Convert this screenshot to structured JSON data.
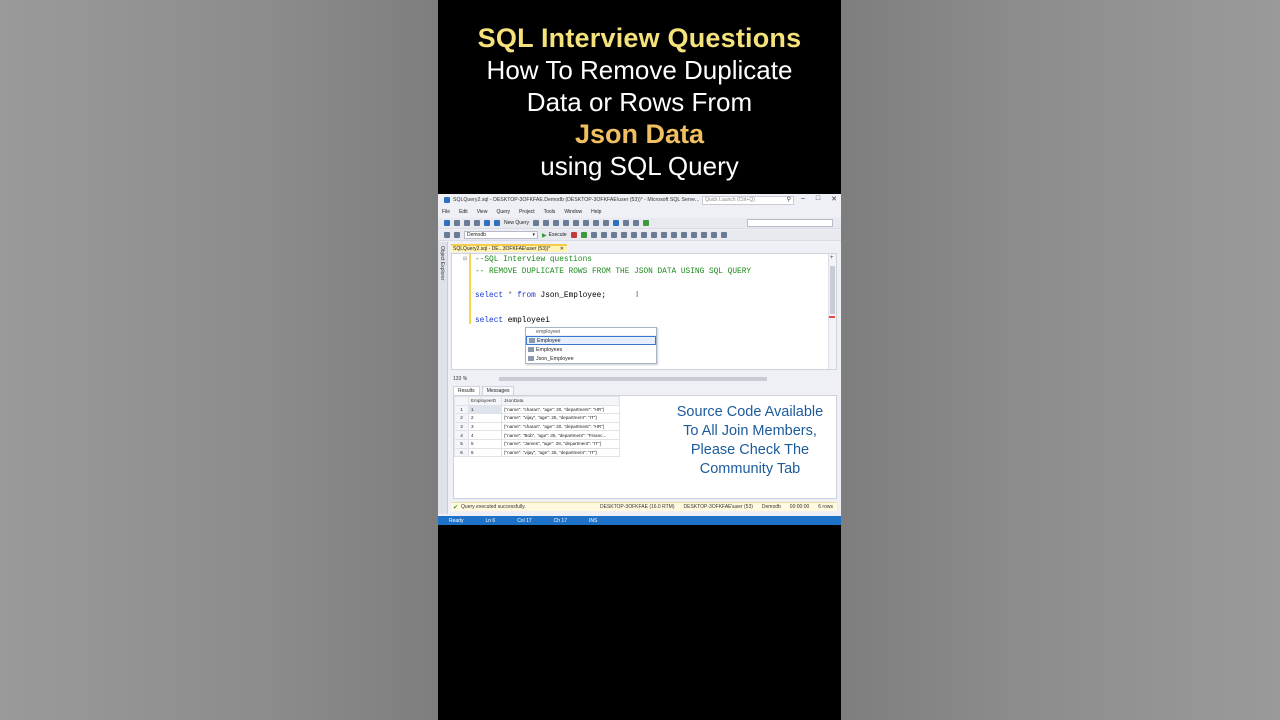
{
  "title": {
    "line1": "SQL Interview Questions",
    "line2": "How To Remove Duplicate",
    "line3": "Data or Rows From",
    "line4": "Json Data",
    "line5": "using SQL Query"
  },
  "window": {
    "title": "SQLQuery2.sql - DESKTOP-3OFKFAE.Demodb (DESKTOP-3OFKFAE\\user (53))* - Microsoft SQL Serve...",
    "quick_launch_placeholder": "Quick Launch (Ctrl+Q)",
    "minimize": "–",
    "maximize": "□",
    "close": "✕"
  },
  "menu": [
    "File",
    "Edit",
    "View",
    "Query",
    "Project",
    "Tools",
    "Window",
    "Help"
  ],
  "toolbar": {
    "new_query": "New Query",
    "database": "Demodb",
    "execute": "Execute"
  },
  "object_explorer": {
    "label": "Object Explorer"
  },
  "doc_tab": {
    "label": "SQLQuery2.sql - DE...3OFKFAE\\user (53))*",
    "close": "✕"
  },
  "editor": {
    "line1": "--SQL Interview questions",
    "line2": "-- REMOVE DUPLICATE ROWS FROM THE JSON DATA USING SQL QUERY",
    "line3_kw1": "select",
    "line3_star": " * ",
    "line3_kw2": "from",
    "line3_rest": " Json_Employee;",
    "line4_kw": "select",
    "line4_rest": " employeei"
  },
  "autocomplete": {
    "header": "employeei",
    "items": [
      "Employee",
      "Employees",
      "Json_Employee"
    ]
  },
  "zoom": {
    "level": "133 %"
  },
  "result_tabs": {
    "results": "Results",
    "messages": "Messages"
  },
  "grid": {
    "columns": [
      "EmployeeID",
      "JsonData"
    ],
    "rows": [
      {
        "n": "1",
        "id": "1",
        "json": "{\"name\": \"charan\", \"age\": 30, \"department\": \"HR\"}"
      },
      {
        "n": "2",
        "id": "2",
        "json": "{\"name\": \"vijay\", \"age\": 25, \"department\": \"IT\"}"
      },
      {
        "n": "3",
        "id": "3",
        "json": "{\"name\": \"charan\", \"age\": 30, \"department\": \"HR\"}"
      },
      {
        "n": "4",
        "id": "4",
        "json": "{\"name\": \"Bob\", \"age\": 35, \"department\": \"Financ..."
      },
      {
        "n": "5",
        "id": "5",
        "json": "{\"name\": \"James\", \"age\": 28, \"department\": \"IT\"}"
      },
      {
        "n": "6",
        "id": "6",
        "json": "{\"name\": \"vijay\", \"age\": 25, \"department\": \"IT\"}"
      }
    ]
  },
  "overlay": {
    "line1": "Source Code Available",
    "line2": "To All  Join Members,",
    "line3": "Please Check The",
    "line4": "Community Tab"
  },
  "status": {
    "message": "Query executed successfully.",
    "server": "DESKTOP-3OFKFAE (16.0 RTM)",
    "user": "DESKTOP-3OFKFAE\\user (53)",
    "db": "Demodb",
    "time": "00:00:00",
    "rows": "6 rows"
  },
  "bottom": {
    "ready": "Ready",
    "ln": "Ln 6",
    "col": "Col 17",
    "ch": "Ch 17",
    "ins": "INS"
  }
}
